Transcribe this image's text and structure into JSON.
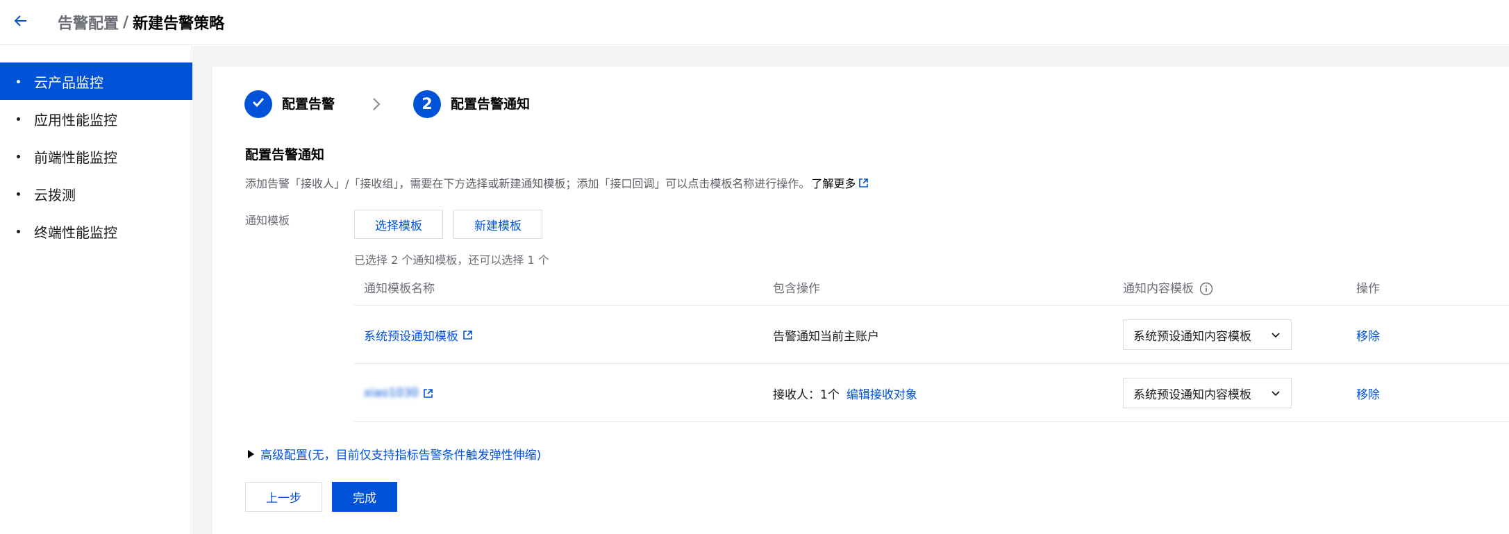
{
  "header": {
    "back_icon": "arrow-left-icon",
    "breadcrumb_parent": "告警配置",
    "breadcrumb_separator": "/",
    "title": "新建告警策略"
  },
  "sidebar": {
    "items": [
      {
        "label": "云产品监控",
        "active": true
      },
      {
        "label": "应用性能监控",
        "active": false
      },
      {
        "label": "前端性能监控",
        "active": false
      },
      {
        "label": "云拨测",
        "active": false
      },
      {
        "label": "终端性能监控",
        "active": false
      }
    ]
  },
  "steps": {
    "step1": {
      "label": "配置告警",
      "icon": "check-icon",
      "status": "done"
    },
    "step2": {
      "number": "2",
      "label": "配置告警通知",
      "status": "current"
    },
    "separator_icon": "chevron-right-icon"
  },
  "section": {
    "title": "配置告警通知",
    "description": "添加告警「接收人」/「接收组」，需要在下方选择或新建通知模板；添加「接口回调」可以点击模板名称进行操作。",
    "learn_more": "了解更多"
  },
  "template_field": {
    "label": "通知模板",
    "select_button": "选择模板",
    "new_button": "新建模板",
    "hint": "已选择 2 个通知模板，还可以选择 1 个"
  },
  "table": {
    "columns": [
      "通知模板名称",
      "包含操作",
      "通知内容模板",
      "操作"
    ],
    "rows": [
      {
        "name": "系统预设通知模板",
        "operation_text": "告警通知当前主账户",
        "operation_link": "",
        "content_template": "系统预设通知内容模板",
        "action": "移除"
      },
      {
        "name": "xiao1030",
        "operation_text": "接收人：1个",
        "operation_link": "编辑接收对象",
        "content_template": "系统预设通知内容模板",
        "action": "移除"
      }
    ]
  },
  "advanced": {
    "label": "高级配置(无，目前仅支持指标告警条件触发弹性伸缩)"
  },
  "footer": {
    "prev_button": "上一步",
    "finish_button": "完成"
  },
  "colors": {
    "primary": "#0052d9",
    "page_bg": "#f2f3f5",
    "border": "#dcdcdc",
    "muted_text": "#6b6e75"
  }
}
